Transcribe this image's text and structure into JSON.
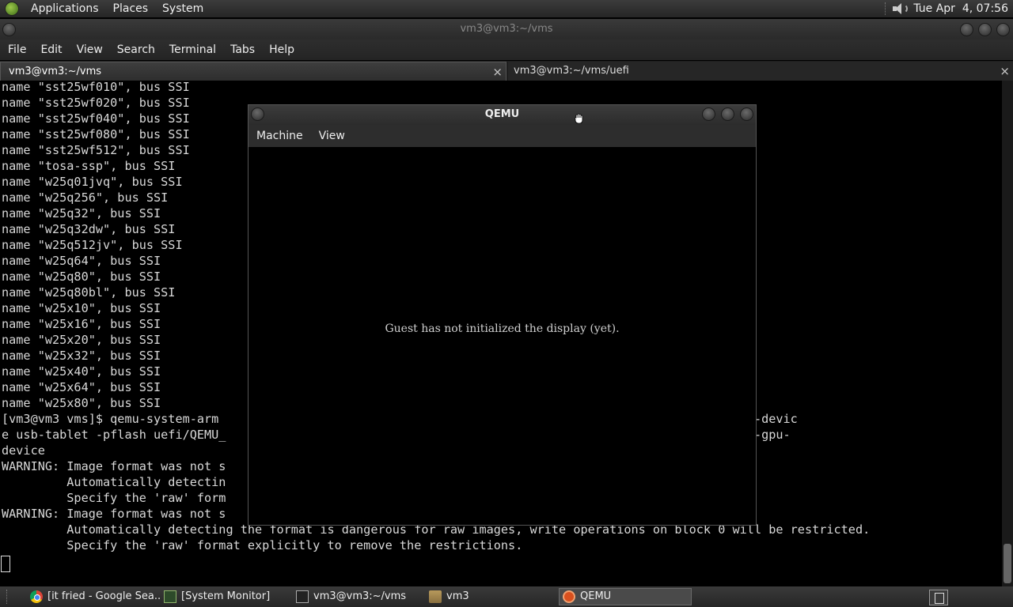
{
  "top_panel": {
    "menus": [
      "Applications",
      "Places",
      "System"
    ],
    "clock": "Tue Apr  4, 07:56"
  },
  "terminal": {
    "title": "vm3@vm3:~/vms",
    "menu": [
      "File",
      "Edit",
      "View",
      "Search",
      "Terminal",
      "Tabs",
      "Help"
    ],
    "tabs": [
      {
        "label": "vm3@vm3:~/vms",
        "close": "×"
      },
      {
        "label": "vm3@vm3:~/vms/uefi",
        "close": "×"
      }
    ],
    "lines": [
      "name \"sst25wf010\", bus SSI",
      "name \"sst25wf020\", bus SSI",
      "name \"sst25wf040\", bus SSI",
      "name \"sst25wf080\", bus SSI",
      "name \"sst25wf512\", bus SSI",
      "name \"tosa-ssp\", bus SSI",
      "name \"w25q01jvq\", bus SSI",
      "name \"w25q256\", bus SSI",
      "name \"w25q32\", bus SSI",
      "name \"w25q32dw\", bus SSI",
      "name \"w25q512jv\", bus SSI",
      "name \"w25q64\", bus SSI",
      "name \"w25q80\", bus SSI",
      "name \"w25q80bl\", bus SSI",
      "name \"w25x10\", bus SSI",
      "name \"w25x16\", bus SSI",
      "name \"w25x20\", bus SSI",
      "name \"w25x32\", bus SSI",
      "name \"w25x40\", bus SSI",
      "name \"w25x64\", bus SSI",
      "name \"w25x80\", bus SSI",
      "[vm3@vm3 vms]$ qemu-system-arm                                                 usb-xhci -device usb-kbd -devic",
      "e usb-tablet -pflash uefi/QEMU_                                                =raw -m 2G -device virtio-gpu-",
      "device",
      "WARNING: Image format was not s",
      "         Automatically detectin                                                ock 0 will be restricted.",
      "         Specify the 'raw' form",
      "WARNING: Image format was not s",
      "         Automatically detecting the format is dangerous for raw images, write operations on block 0 will be restricted.",
      "         Specify the 'raw' format explicitly to remove the restrictions."
    ]
  },
  "qemu": {
    "title": "QEMU",
    "menu": [
      "Machine",
      "View"
    ],
    "message": "Guest has not initialized the display (yet)."
  },
  "taskbar": {
    "items": [
      {
        "label": "[it fried - Google Sea...",
        "icon": "chrome-icon"
      },
      {
        "label": "[System Monitor]",
        "icon": "system-monitor-icon"
      },
      {
        "label": "vm3@vm3:~/vms",
        "icon": "terminal-icon"
      },
      {
        "label": "vm3",
        "icon": "folder-icon"
      },
      {
        "label": "QEMU",
        "icon": "qemu-icon",
        "active": true
      }
    ]
  }
}
